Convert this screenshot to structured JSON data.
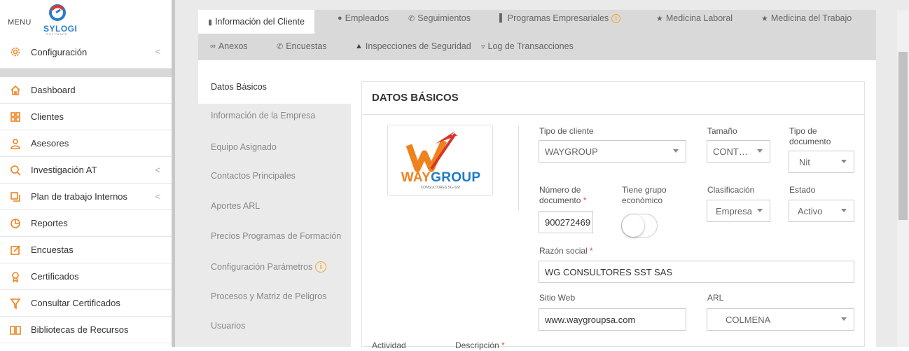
{
  "sidebar": {
    "menu_label": "MENU",
    "logo_text": "SYLOGI",
    "logo_sub": "SOFTWARE",
    "config": {
      "label": "Configuración",
      "icon": "gear-icon"
    },
    "items": [
      {
        "label": "Dashboard",
        "icon": "home-icon",
        "chevron": false
      },
      {
        "label": "Clientes",
        "icon": "grid-icon",
        "chevron": false
      },
      {
        "label": "Asesores",
        "icon": "user-icon",
        "chevron": false
      },
      {
        "label": "Investigación AT",
        "icon": "search-icon",
        "chevron": true
      },
      {
        "label": "Plan de trabajo Internos",
        "icon": "copy-icon",
        "chevron": true
      },
      {
        "label": "Reportes",
        "icon": "pie-icon",
        "chevron": false
      },
      {
        "label": "Encuestas",
        "icon": "edit-icon",
        "chevron": false
      },
      {
        "label": "Certificados",
        "icon": "medal-icon",
        "chevron": false
      },
      {
        "label": "Consultar Certificados",
        "icon": "filter-icon",
        "chevron": false
      },
      {
        "label": "Bibliotecas de Recursos",
        "icon": "book-icon",
        "chevron": false
      }
    ]
  },
  "tabs_row1": [
    {
      "label": "Información del Cliente",
      "icon": "file-icon",
      "active": true
    },
    {
      "label": "Empleados",
      "icon": "user-icon"
    },
    {
      "label": "Seguimientos",
      "icon": "phone-icon"
    },
    {
      "label": "Programas Empresariales",
      "icon": "bar-chart-icon",
      "alert": "i"
    },
    {
      "label": "Medicina Laboral",
      "icon": "star-icon"
    },
    {
      "label": "Medicina del Trabajo",
      "icon": "star-icon"
    }
  ],
  "tabs_row2": [
    {
      "label": "Anexos",
      "icon": "paperclip-icon"
    },
    {
      "label": "Encuestas",
      "icon": "phone-icon"
    },
    {
      "label": "Inspecciones de Seguridad",
      "icon": "warning-icon"
    },
    {
      "label": "Log de Transacciones",
      "icon": "filter-icon"
    }
  ],
  "subnav": [
    "Datos Básicos",
    "Información de la Empresa",
    "Equipo Asignado",
    "Contactos Principales",
    "Aportes ARL",
    "Precios Programas de Formación",
    "Configuración Parámetros",
    "Procesos y Matriz de Peligros",
    "Usuarios"
  ],
  "subnav_alert": "i",
  "card": {
    "title": "DATOS BÁSICOS",
    "logo": {
      "brand_a": "WAY",
      "brand_b": "GROUP",
      "tagline": "CONSULTORES SG-SST"
    },
    "tipo_cliente": {
      "label": "Tipo de cliente",
      "value": "WAYGROUP"
    },
    "tamano": {
      "label": "Tamaño",
      "value": "CONT…"
    },
    "tipo_documento": {
      "label_1": "Tipo de",
      "label_2": "documento",
      "value": "Nit"
    },
    "numero_documento": {
      "label_1": "Número de",
      "label_2": "documento",
      "required": "*",
      "value": "900272469"
    },
    "grupo_economico": {
      "label_1": "Tiene grupo",
      "label_2": "económico",
      "on": false
    },
    "clasificacion": {
      "label": "Clasificación",
      "value": "Empresa"
    },
    "estado": {
      "label": "Estado",
      "value": "Activo"
    },
    "razon_social": {
      "label": "Razón social",
      "required": "*",
      "value": "WG CONSULTORES SST SAS"
    },
    "sitio_web": {
      "label": "Sitio Web",
      "value": "www.waygroupsa.com"
    },
    "arl": {
      "label": "ARL",
      "value": "COLMENA"
    },
    "actividad": {
      "label": "Actividad"
    },
    "descripcion": {
      "label": "Descripción",
      "required": "*"
    }
  },
  "colors": {
    "accent": "#f0821e",
    "logo_blue": "#2a7ec8",
    "alert": "#f5a623"
  }
}
